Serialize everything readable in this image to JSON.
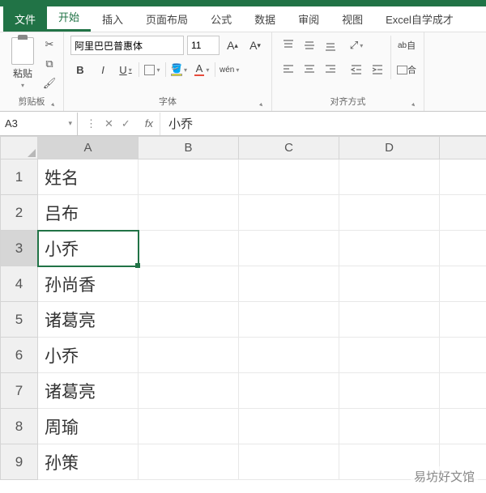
{
  "tabs": {
    "file": "文件",
    "home": "开始",
    "insert": "插入",
    "layout": "页面布局",
    "formulas": "公式",
    "data": "数据",
    "review": "审阅",
    "view": "视图",
    "custom": "Excel自学成才"
  },
  "ribbon": {
    "clipboard": {
      "paste": "粘贴",
      "label": "剪贴板"
    },
    "font": {
      "family": "阿里巴巴普惠体",
      "size": "11",
      "bold": "B",
      "italic": "I",
      "underline": "U",
      "wen": "wén",
      "label": "字体",
      "grow": "A",
      "shrink": "A"
    },
    "align": {
      "label": "对齐方式",
      "orient": "ab",
      "wrap": "ab",
      "merge": "合"
    },
    "auto": "自"
  },
  "formula_bar": {
    "cell_ref": "A3",
    "value": "小乔",
    "fx": "fx"
  },
  "columns": [
    "A",
    "B",
    "C",
    "D",
    ""
  ],
  "rows": [
    {
      "n": "1",
      "A": "姓名"
    },
    {
      "n": "2",
      "A": "吕布"
    },
    {
      "n": "3",
      "A": "小乔"
    },
    {
      "n": "4",
      "A": "孙尚香"
    },
    {
      "n": "5",
      "A": "诸葛亮"
    },
    {
      "n": "6",
      "A": "小乔"
    },
    {
      "n": "7",
      "A": "诸葛亮"
    },
    {
      "n": "8",
      "A": "周瑜"
    },
    {
      "n": "9",
      "A": "孙策"
    }
  ],
  "active_cell": "A3",
  "watermark": "易坊好文馆"
}
